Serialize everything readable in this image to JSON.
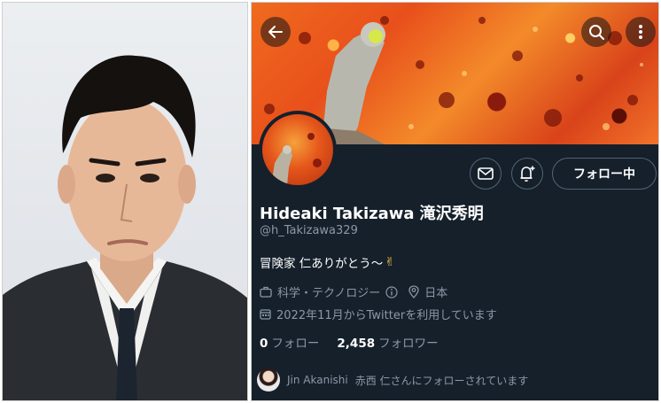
{
  "profile": {
    "name": "Hideaki Takizawa 滝沢秀明",
    "handle": "@h_Takizawa329",
    "bio": "冒険家 仁ありがとう〜",
    "bio_emoji": "✌",
    "category": "科学・テクノロジー",
    "location": "日本",
    "joined": "2022年11月からTwitterを利用しています",
    "following_count": "0",
    "following_label": "フォロー",
    "followers_count": "2,458",
    "followers_label": "フォロワー",
    "follow_button_label": "フォロー中"
  },
  "followed_by": {
    "name": "Jin Akanishi",
    "text": "赤西 仁さんにフォローされています"
  },
  "icons": {
    "back": "back-arrow-icon",
    "search": "search-icon",
    "more": "more-vertical-icon",
    "mail": "mail-icon",
    "notify": "bell-plus-icon",
    "category": "briefcase-icon",
    "info": "info-icon",
    "location": "location-pin-icon",
    "calendar": "calendar-icon"
  },
  "colors": {
    "background": "#15202b",
    "text_primary": "#ffffff",
    "text_secondary": "#8b98a5",
    "border": "#536471",
    "banner_orange": "#e8501b"
  }
}
